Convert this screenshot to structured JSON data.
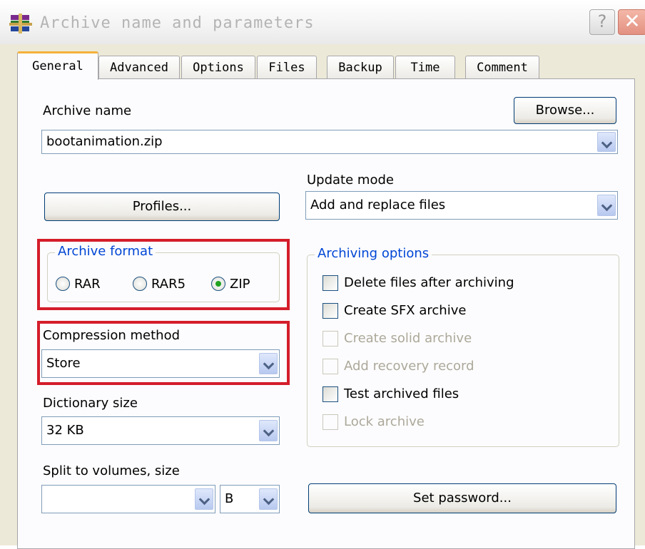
{
  "window": {
    "title": "Archive name and parameters",
    "help_label": "?",
    "close_label": "✕"
  },
  "tabs": [
    "General",
    "Advanced",
    "Options",
    "Files",
    "Backup",
    "Time",
    "Comment"
  ],
  "archive_name": {
    "label": "Archive name",
    "value": "bootanimation.zip",
    "browse_label": "Browse..."
  },
  "update_mode": {
    "label": "Update mode",
    "value": "Add and replace files"
  },
  "profiles_label": "Profiles...",
  "archive_format": {
    "title": "Archive format",
    "options": [
      "RAR",
      "RAR5",
      "ZIP"
    ],
    "selected": "ZIP"
  },
  "compression_method": {
    "label": "Compression method",
    "value": "Store"
  },
  "dictionary_size": {
    "label": "Dictionary size",
    "value": "32 KB"
  },
  "split_volumes": {
    "label": "Split to volumes, size",
    "value": "",
    "unit": "B"
  },
  "archiving_options": {
    "title": "Archiving options",
    "items": [
      {
        "label": "Delete files after archiving",
        "checked": false,
        "enabled": true
      },
      {
        "label": "Create SFX archive",
        "checked": false,
        "enabled": true
      },
      {
        "label": "Create solid archive",
        "checked": false,
        "enabled": false
      },
      {
        "label": "Add recovery record",
        "checked": false,
        "enabled": false
      },
      {
        "label": "Test archived files",
        "checked": false,
        "enabled": true
      },
      {
        "label": "Lock archive",
        "checked": false,
        "enabled": false
      }
    ]
  },
  "set_password_label": "Set password...",
  "colors": {
    "highlight_box": "#d41d2b",
    "group_title": "#0046d5",
    "tab_accent": "#f5b13b"
  }
}
